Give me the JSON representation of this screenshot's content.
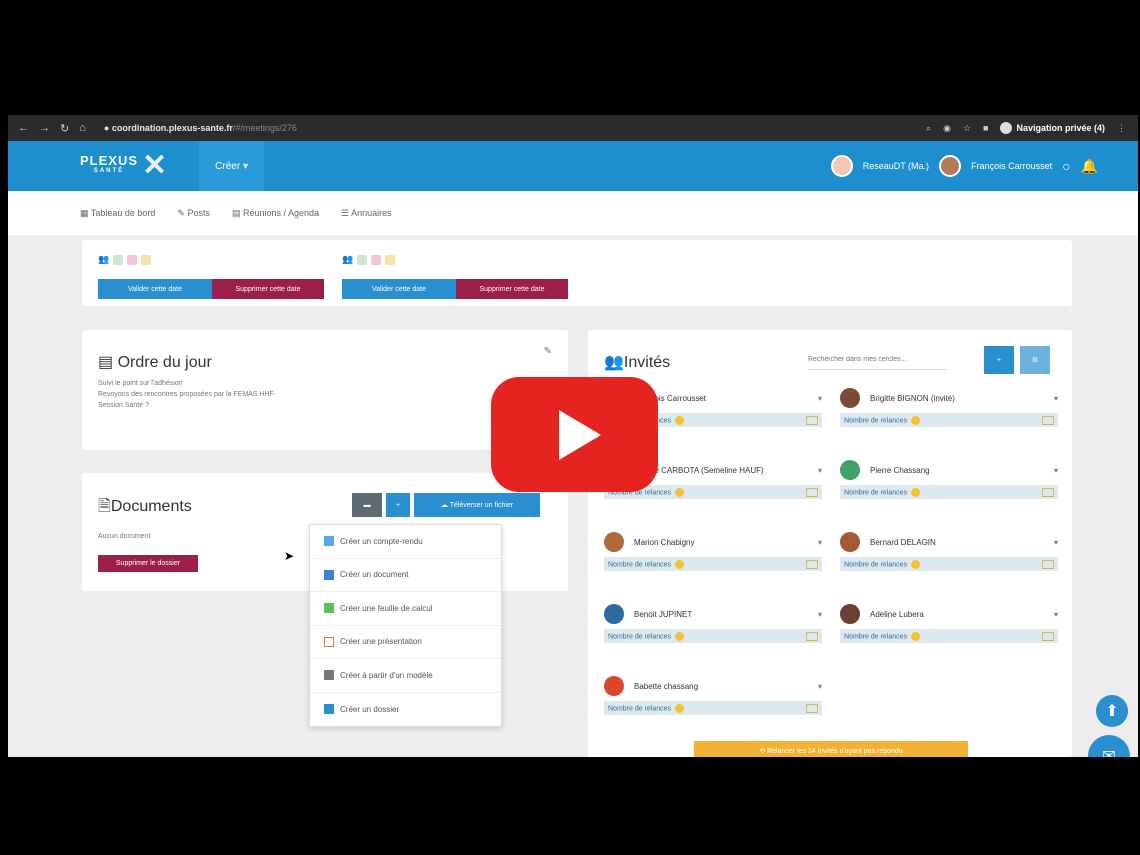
{
  "browser": {
    "url_host": "coordination.plexus-sante.fr",
    "url_path": "/#/meetings/276",
    "incognito_label": "Navigation privée (4)"
  },
  "header": {
    "logo_text": "PLEXUS",
    "logo_sub": "SANTÉ",
    "create_label": "Créer",
    "org_label": "ReseauDT (Ma.)",
    "user_label": "François Carrousset"
  },
  "tabs": [
    "Tableau de bord",
    "Posts",
    "Réunions / Agenda",
    "Annuaires"
  ],
  "dates": {
    "validate_label": "Valider cette date",
    "delete_label": "Supprimer cette date"
  },
  "agenda": {
    "title": "Ordre du jour",
    "lines": [
      "Suivi le point sur l'adhésion",
      "Revoyons des rencontres proposées par la FEMAS HHF",
      "Session Santé ?"
    ]
  },
  "documents": {
    "title": "Documents",
    "empty_label": "Aucun document",
    "delete_folder_label": "Supprimer le dossier",
    "upload_label": "Téléverser un fichier",
    "add_label": "+",
    "menu": [
      {
        "label": "Créer un compte-rendu",
        "icon": "doc-blue-icon"
      },
      {
        "label": "Créer un document",
        "icon": "doc-icon"
      },
      {
        "label": "Créer une feuille de calcul",
        "icon": "sheet-icon"
      },
      {
        "label": "Créer une présentation",
        "icon": "slides-icon"
      },
      {
        "label": "Créer à partir d'un modèle",
        "icon": "template-icon"
      },
      {
        "label": "Créer un dossier",
        "icon": "folder-icon"
      }
    ]
  },
  "invites": {
    "title": "Invités",
    "search_placeholder": "Rechercher dans mes cercles...",
    "reply_label": "Nombre de relances",
    "people": [
      {
        "name": "François Carrousset"
      },
      {
        "name": "Brigitte BIGNON (invité)"
      },
      {
        "name": "Brigitte CARBOTA (Semeline HAUF)"
      },
      {
        "name": "Pierre Chassang"
      },
      {
        "name": "Marion Chabigny"
      },
      {
        "name": "Bernard DELAGIN"
      },
      {
        "name": "Benoit JUPINET"
      },
      {
        "name": "Adeline Lubera"
      },
      {
        "name": "Babette chassang"
      }
    ],
    "footer_label": "Relancer les 14 invités n'ayant pas répondu"
  },
  "colors": {
    "brand_blue": "#1d8fcf",
    "danger": "#9b1f4a",
    "youtube_red": "#e52421"
  }
}
